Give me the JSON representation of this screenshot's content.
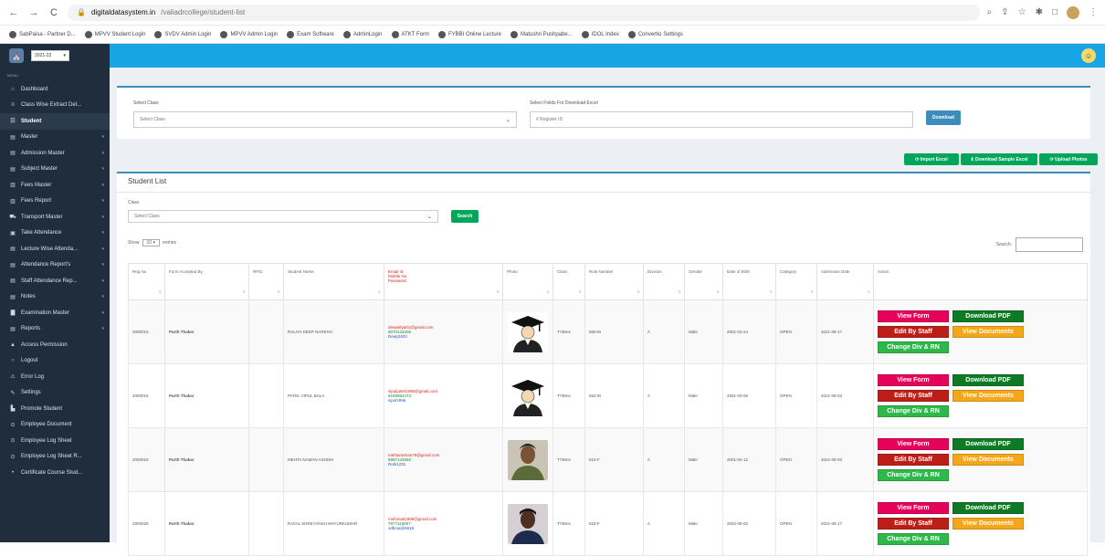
{
  "browser": {
    "url_host": "digitaldatasystem.in",
    "url_path": "/valiadrcollege/student-list",
    "bookmarks": [
      "SabPaisa - Partner D...",
      "MPVV Student Login",
      "SVDV Admin Login",
      "MPVV Admin Login",
      "Exam Software",
      "AdminLogin",
      "ATKT Form",
      "FYBBI Online Lecture",
      "Matushri Pushpabe...",
      "IDOL Index",
      "Convertio Settings"
    ]
  },
  "topbar": {
    "year": "2021-22"
  },
  "sidebar": {
    "caption": "MENU",
    "items": [
      {
        "icon": "⌂",
        "label": "Dashboard",
        "arrow": ""
      },
      {
        "icon": "≡",
        "label": "Class Wise Extract Det...",
        "arrow": ""
      },
      {
        "icon": "☷",
        "label": "Student",
        "arrow": ""
      },
      {
        "icon": "▤",
        "label": "Master",
        "arrow": "▾"
      },
      {
        "icon": "▤",
        "label": "Admission Master",
        "arrow": "▾"
      },
      {
        "icon": "▤",
        "label": "Subject Master",
        "arrow": "▾"
      },
      {
        "icon": "▥",
        "label": "Fees Master",
        "arrow": "▾"
      },
      {
        "icon": "▥",
        "label": "Fees Report",
        "arrow": "▾"
      },
      {
        "icon": "⛟",
        "label": "Transport Master",
        "arrow": "▾"
      },
      {
        "icon": "▣",
        "label": "Take Attendance",
        "arrow": "▾"
      },
      {
        "icon": "▤",
        "label": "Lecture Wise Attenda...",
        "arrow": "▾"
      },
      {
        "icon": "▤",
        "label": "Attendance Report's",
        "arrow": "▾"
      },
      {
        "icon": "▤",
        "label": "Staff Attendance Rep...",
        "arrow": "▾"
      },
      {
        "icon": "▤",
        "label": "Notes",
        "arrow": "▾"
      },
      {
        "icon": "▇",
        "label": "Examination Master",
        "arrow": "▾"
      },
      {
        "icon": "▤",
        "label": "Reports",
        "arrow": "▾"
      },
      {
        "icon": "▲",
        "label": "Access Permission",
        "arrow": ""
      },
      {
        "icon": "○",
        "label": "Logout",
        "arrow": ""
      },
      {
        "icon": "⚠",
        "label": "Error Log",
        "arrow": ""
      },
      {
        "icon": "✎",
        "label": "Settings",
        "arrow": ""
      },
      {
        "icon": "▙",
        "label": "Promote Student",
        "arrow": ""
      },
      {
        "icon": "⊙",
        "label": "Employee Document",
        "arrow": ""
      },
      {
        "icon": "⊙",
        "label": "Employee Log Sheet",
        "arrow": ""
      },
      {
        "icon": "⊙",
        "label": "Employee Log Sheet R...",
        "arrow": ""
      },
      {
        "icon": "•",
        "label": "Certificate Course Stud...",
        "arrow": ""
      }
    ]
  },
  "filter_box": {
    "class_label": "Select Class",
    "class_value": "Select Class",
    "fields_label": "Select Fields For Download Excel",
    "fields_value": "# Register ID",
    "download_btn": "Download"
  },
  "actions_bar": {
    "import_btn": "⟳ Import Excel",
    "sample_btn": "⬇ Download Sample Excel",
    "photos_btn": "⟳ Upload Photos"
  },
  "list": {
    "title": "Student List",
    "class_label": "Class",
    "class_value": "Select Class",
    "search_btn": "Search",
    "show_label": "Show",
    "show_value": "10",
    "entries_label": "entries",
    "search_label": "Search:"
  },
  "table": {
    "headers": [
      "Reg No",
      "Form Accepted By",
      "RFID",
      "Student Name",
      "Email Id\nMobile No.\nPassword",
      "Photo",
      "Class",
      "Role Number",
      "Division",
      "Gender",
      "Date of Birth",
      "Category",
      "Admission Date",
      "Action"
    ],
    "rows": [
      {
        "reg": "2000010",
        "by": "Parth Thakar",
        "rfid": "",
        "name": "RALIYA DEEP NARESH",
        "email": "deepaliya01@gmail.com",
        "mobile": "8070133405",
        "password": "Deep2403",
        "photo": "placeholder",
        "class": "TYBms",
        "roll": "650-M",
        "div": "A",
        "gender": "Male",
        "dob": "2001-03-24",
        "cat": "OPEN",
        "adm": "2021-08-17"
      },
      {
        "reg": "2000016",
        "by": "Parth Thakar",
        "rfid": "",
        "name": "PATEL VIPUL BALA",
        "email": "vipulpatel1995@gmail.com",
        "mobile": "8169984473",
        "password": "vipul1996",
        "photo": "placeholder",
        "class": "TYBms",
        "roll": "652-M",
        "div": "A",
        "gender": "Male",
        "dob": "2001-03-06",
        "cat": "OPEN",
        "adm": "2021-08-03"
      },
      {
        "reg": "2000019",
        "by": "Parth Thakar",
        "rfid": "",
        "name": "MEHTA NAMAN ASHISH",
        "email": "mehtanaman76@gmail.com",
        "mobile": "8987144592",
        "password": "Rohi1231",
        "photo": "real",
        "class": "TYBms",
        "roll": "615-F",
        "div": "A",
        "gender": "Male",
        "dob": "2001-04-12",
        "cat": "OPEN",
        "adm": "2021-08-03"
      },
      {
        "reg": "2000020",
        "by": "Parth Thakar",
        "rfid": "",
        "name": "RAVAL SHREYANSH MAYURKUMAR",
        "email": "mshraval1998@gmail.com",
        "mobile": "7977116867",
        "password": "sdbma@8618",
        "photo": "real2",
        "class": "TYBms",
        "roll": "622-F",
        "div": "A",
        "gender": "Male",
        "dob": "2002-06-02",
        "cat": "OPEN",
        "adm": "2021-08-17"
      }
    ],
    "action_labels": {
      "view_form": "View Form",
      "download_pdf": "Download PDF",
      "edit_by_staff": "Edit By Staff",
      "view_documents": "View Documents",
      "change_div": "Change Div & RN"
    }
  },
  "colors": {
    "topbar": "#18a5e3",
    "sidebar": "#1f2d3d",
    "view_form": "#e5005a",
    "download_pdf": "#0e7a25",
    "edit": "#bb1f17",
    "documents": "#f5a71c",
    "change_div": "#2eb84a"
  }
}
